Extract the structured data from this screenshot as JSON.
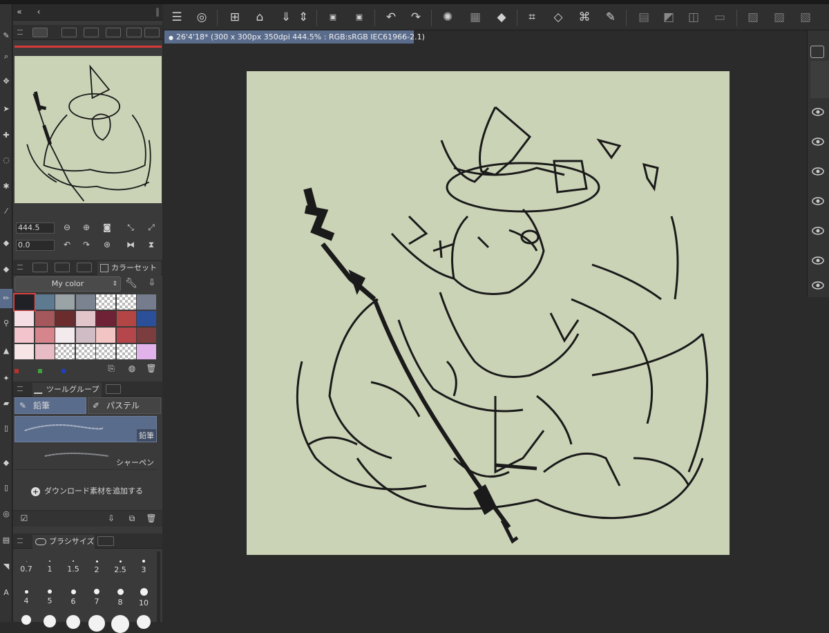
{
  "document": {
    "tab_title": "26'4'18* (300 x 300px 350dpi 444.5% : RGB:sRGB IEC61966-2.1)"
  },
  "navigator": {
    "zoom_value": "444.5",
    "rotate_value": "0.0"
  },
  "color_set": {
    "tab_label": "カラーセット",
    "set_name": "My color",
    "swatches": [
      [
        "#1f2126",
        "#5e7a90",
        "#9aa3a6",
        "#7b8290",
        "checker",
        "checker",
        "#747c8e"
      ],
      [
        "#f6dfe4",
        "#a4585b",
        "#6b2c2e",
        "#e2c5cb",
        "#6f2135",
        "#b34545",
        "#2c4f9a"
      ],
      [
        "#f3c4cc",
        "#d6858c",
        "#f3eaee",
        "#cfbcc4",
        "#f2c4c4",
        "#b5464b",
        "#7b3d3e"
      ],
      [
        "#f6e4e7",
        "#e7bcc4",
        "checker",
        "checker",
        "checker",
        "checker",
        "#e2b3ea"
      ]
    ]
  },
  "tool_group": {
    "tab_label": "ツールグループ",
    "tab_pencil": "鉛筆",
    "tab_pastel": "パステル",
    "brushes": [
      {
        "name": "鉛筆",
        "selected": true
      },
      {
        "name": "シャーペン",
        "selected": false
      }
    ],
    "download_label": "ダウンロード素材を追加する"
  },
  "brush_size": {
    "tab_label": "ブラシサイズ",
    "sizes_row1": [
      "0.7",
      "1",
      "1.5",
      "2",
      "2.5",
      "3"
    ],
    "sizes_row2": [
      "4",
      "5",
      "6",
      "7",
      "8",
      "10"
    ]
  },
  "colors": {
    "accent": "#5a6c8c",
    "canvas_bg": "#cad3b6",
    "red_line": "#d83a3a"
  }
}
